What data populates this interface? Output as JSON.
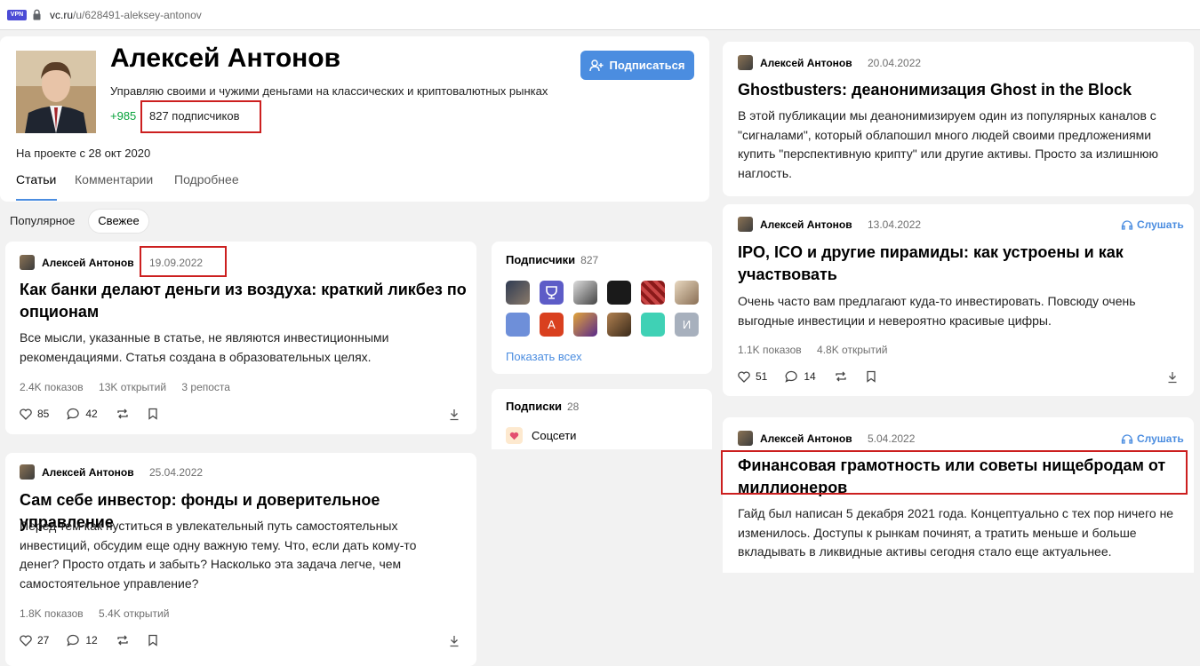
{
  "browser": {
    "vpn_badge": "VPN",
    "url_host": "vc.ru",
    "url_path": "/u/628491-aleksey-antonov"
  },
  "profile": {
    "name": "Алексей Антонов",
    "bio": "Управляю своими и чужими деньгами на классических и криптовалютных рынках",
    "karma": "+985",
    "subscribers": "827 подписчиков",
    "since": "На проекте с 28 окт 2020",
    "subscribe_label": "Подписаться",
    "tabs": [
      "Статьи",
      "Комментарии",
      "Подробнее"
    ]
  },
  "sort": {
    "popular": "Популярное",
    "fresh": "Свежее"
  },
  "left_posts": [
    {
      "author": "Алексей Антонов",
      "date": "19.09.2022",
      "title": "Как банки делают деньги из воздуха: краткий ликбез по опционам",
      "text": "Все мысли, указанные в статье, не являются инвестиционными рекомендациями. Статья создана в образовательных целях.",
      "views": "2.4K показов",
      "opens": "13K открытий",
      "reposts": "3 репоста",
      "likes": "85",
      "comments": "42"
    },
    {
      "author": "Алексей Антонов",
      "date": "25.04.2022",
      "title": "Сам себе инвестор: фонды и доверительное управление",
      "text": "Перед тем как пуститься в увлекательный путь самостоятельных инвестиций, обсудим еще одну важную тему. Что, если дать кому-то денег? Просто отдать и забыть? Насколько эта задача легче, чем самостоятельное управление?",
      "views": "1.8K показов",
      "opens": "5.4K открытий",
      "likes": "27",
      "comments": "12"
    }
  ],
  "sidebar": {
    "subscribers_title": "Подписчики",
    "subscribers_count": "827",
    "avatar_letters": [
      "А",
      "И"
    ],
    "show_all": "Показать всех",
    "subscriptions_title": "Подписки",
    "subscriptions_count": "28",
    "subscription_item": "Соцсети"
  },
  "right_posts": [
    {
      "author": "Алексей Антонов",
      "date": "20.04.2022",
      "title": "Ghostbusters: деанонимизация Ghost in the Block",
      "text": "В этой публикации мы деанонимизируем один из популярных каналов с \"сигналами\", который облапошил много людей своими предложениями купить \"перспективную крипту\" или другие активы. Просто за излишнюю наглость."
    },
    {
      "author": "Алексей Антонов",
      "date": "13.04.2022",
      "listen": "Слушать",
      "title": "IPO, ICO и другие пирамиды: как устроены и как участвовать",
      "text": "Очень часто вам предлагают куда-то инвестировать. Повсюду очень выгодные инвестиции и невероятно красивые цифры.",
      "views": "1.1K показов",
      "opens": "4.8K открытий",
      "likes": "51",
      "comments": "14"
    },
    {
      "author": "Алексей Антонов",
      "date": "5.04.2022",
      "listen": "Слушать",
      "title": "Финансовая грамотность или советы нищебродам от миллионеров",
      "text": "Гайд был написан 5 декабря 2021 года. Концептуально с тех пор ничего не изменилось. Доступы к рынкам починят, а тратить меньше и больше вкладывать в ликвидные активы сегодня стало еще актуальнее."
    }
  ],
  "colors": {
    "accent": "#4b8de0",
    "karma": "#07a23b",
    "highlight": "#cc1f1f"
  }
}
